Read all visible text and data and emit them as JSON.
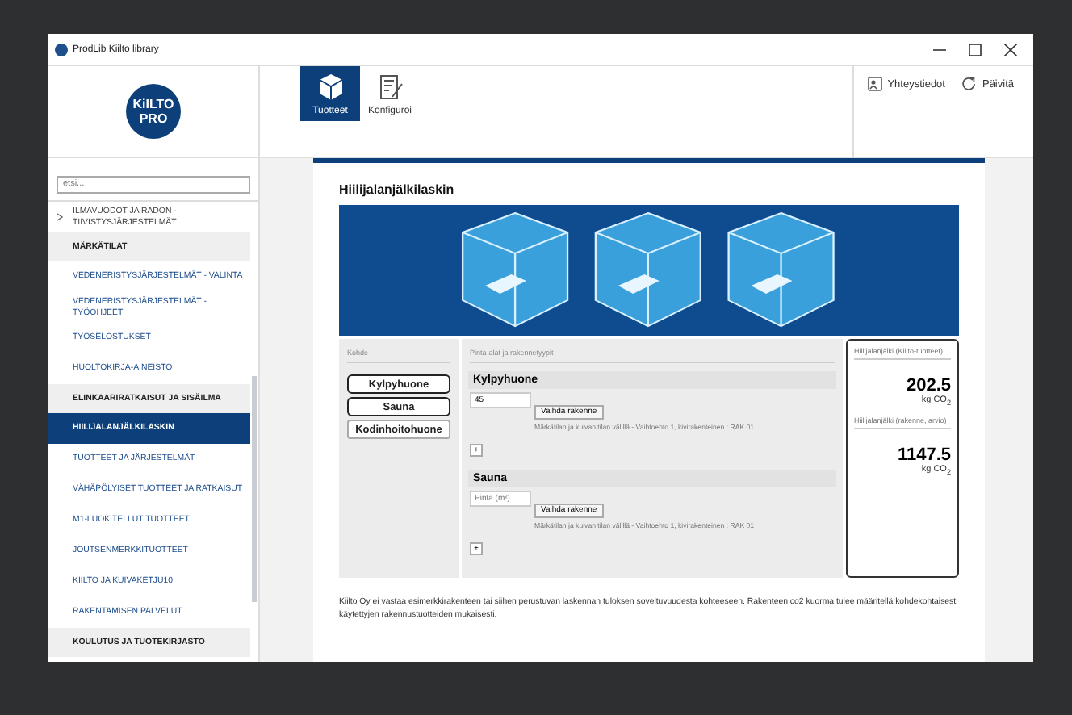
{
  "window": {
    "title": "ProdLib Kiilto library"
  },
  "header": {
    "logo": {
      "line1": "KiILTO",
      "line2": "PRO"
    },
    "tabs": [
      {
        "label": "Tuotteet",
        "selected": true,
        "kind": "box"
      },
      {
        "label": "Konfiguroi",
        "selected": false,
        "kind": "tools"
      }
    ],
    "actions": [
      {
        "label": "Yhteystiedot",
        "kind": "contact"
      },
      {
        "label": "Päivitä",
        "kind": "refresh"
      }
    ]
  },
  "sidebar": {
    "search": {
      "placeholder": "etsi..."
    },
    "items": [
      {
        "kind": "group",
        "label": "ILMAVUODOT JA RADON - TIIVISTYSJÄRJESTELMÄT",
        "expanded": false
      },
      {
        "kind": "category",
        "label": "MÄRKÄTILAT"
      },
      {
        "kind": "link",
        "label": "VEDENERISTYSJÄRJESTELMÄT - VALINTA",
        "selected": false
      },
      {
        "kind": "link",
        "label": "VEDENERISTYSJÄRJESTELMÄT - TYÖOHJEET",
        "selected": false
      },
      {
        "kind": "link",
        "label": "TYÖSELOSTUKSET",
        "selected": false
      },
      {
        "kind": "link",
        "label": "HUOLTOKIRJA-AINEISTO",
        "selected": false
      },
      {
        "kind": "category",
        "label": "ELINKAARIRATKAISUT JA SISÄILMA"
      },
      {
        "kind": "link",
        "label": "HIILIJALANJÄLKILASKIN",
        "selected": true
      },
      {
        "kind": "link",
        "label": "TUOTTEET JA JÄRJESTELMÄT",
        "selected": false
      },
      {
        "kind": "link",
        "label": "VÄHÄPÖLYISET TUOTTEET JA RATKAISUT",
        "selected": false
      },
      {
        "kind": "link",
        "label": "M1-LUOKITELLUT TUOTTEET",
        "selected": false
      },
      {
        "kind": "link",
        "label": "JOUTSENMERKKITUOTTEET",
        "selected": false
      },
      {
        "kind": "link",
        "label": "KIILTO JA KUIVAKETJU10",
        "selected": false
      },
      {
        "kind": "link",
        "label": "RAKENTAMISEN PALVELUT",
        "selected": false
      },
      {
        "kind": "category",
        "label": "KOULUTUS JA TUOTEKIRJASTO"
      }
    ]
  },
  "content": {
    "title": "Hiilijalanjälkilaskin",
    "calculator": {
      "targets_heading": "Kohde",
      "targets": [
        {
          "label": "Kylpyhuone",
          "selected": true
        },
        {
          "label": "Sauna",
          "selected": true
        },
        {
          "label": "Kodinhoitohuone",
          "selected": false
        }
      ],
      "areas_heading": "Pinta-alat ja rakennetyypit",
      "sections": [
        {
          "title": "Kylpyhuone",
          "value": "45",
          "button": "Vaihda rakenne",
          "description": "Märkätilan ja kuivan tilan välillä - Vaihtoehto 1, kivirakenteinen : RAK 01",
          "add": "+"
        },
        {
          "title": "Sauna",
          "placeholder": "Pinta (m²)",
          "button": "Vaihda rakenne",
          "description": "Märkätilan ja kuivan tilan välillä - Vaihtoehto 1, kivirakenteinen : RAK 01",
          "add": "+"
        }
      ],
      "results": [
        {
          "label": "Hiilijalanjälki (Kiilto-tuotteet)",
          "value": "202.5",
          "unit": "kg CO$_{2}$"
        },
        {
          "label": "Hiilijalanjälki (rakenne, arvio)",
          "value": "1147.5",
          "unit": "kg CO$_{2}$"
        }
      ]
    },
    "disclaimer": "Kiilto Oy ei vastaa esimerkkirakenteen tai siihen perustuvan laskennan tuloksen soveltuvuudesta kohteeseen. Rakenteen co2 kuorma tulee määritellä kohdekohtaisesti käytettyjen rakennustuotteiden mukaisesti."
  }
}
